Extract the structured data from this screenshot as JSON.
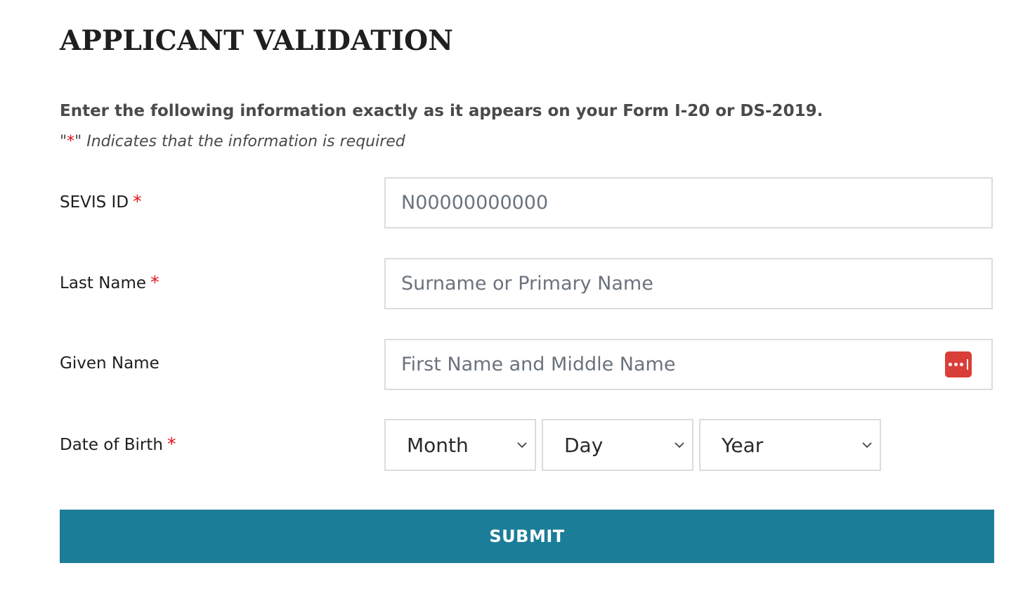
{
  "page": {
    "title": "APPLICANT VALIDATION",
    "instructions": "Enter the following information exactly as it appears on your Form I-20 or DS-2019.",
    "required_note": {
      "quote_open": "\"",
      "star": "*",
      "text": "\" Indicates that the information is required"
    }
  },
  "form": {
    "required_marker": "*",
    "sevis_id": {
      "label": "SEVIS ID",
      "value": "",
      "placeholder": "N00000000000"
    },
    "last_name": {
      "label": "Last Name",
      "value": "",
      "placeholder": "Surname or Primary Name"
    },
    "given_name": {
      "label": "Given Name",
      "value": "",
      "placeholder": "First Name and Middle Name",
      "autofill_icon": "password-manager-icon"
    },
    "date_of_birth": {
      "label": "Date of Birth",
      "month": "Month",
      "day": "Day",
      "year": "Year"
    },
    "submit_label": "SUBMIT"
  },
  "colors": {
    "accent": "#1c7d98",
    "required_star": "#e0131a",
    "autofill_badge": "#d93f38",
    "border": "#dcdcdc"
  }
}
